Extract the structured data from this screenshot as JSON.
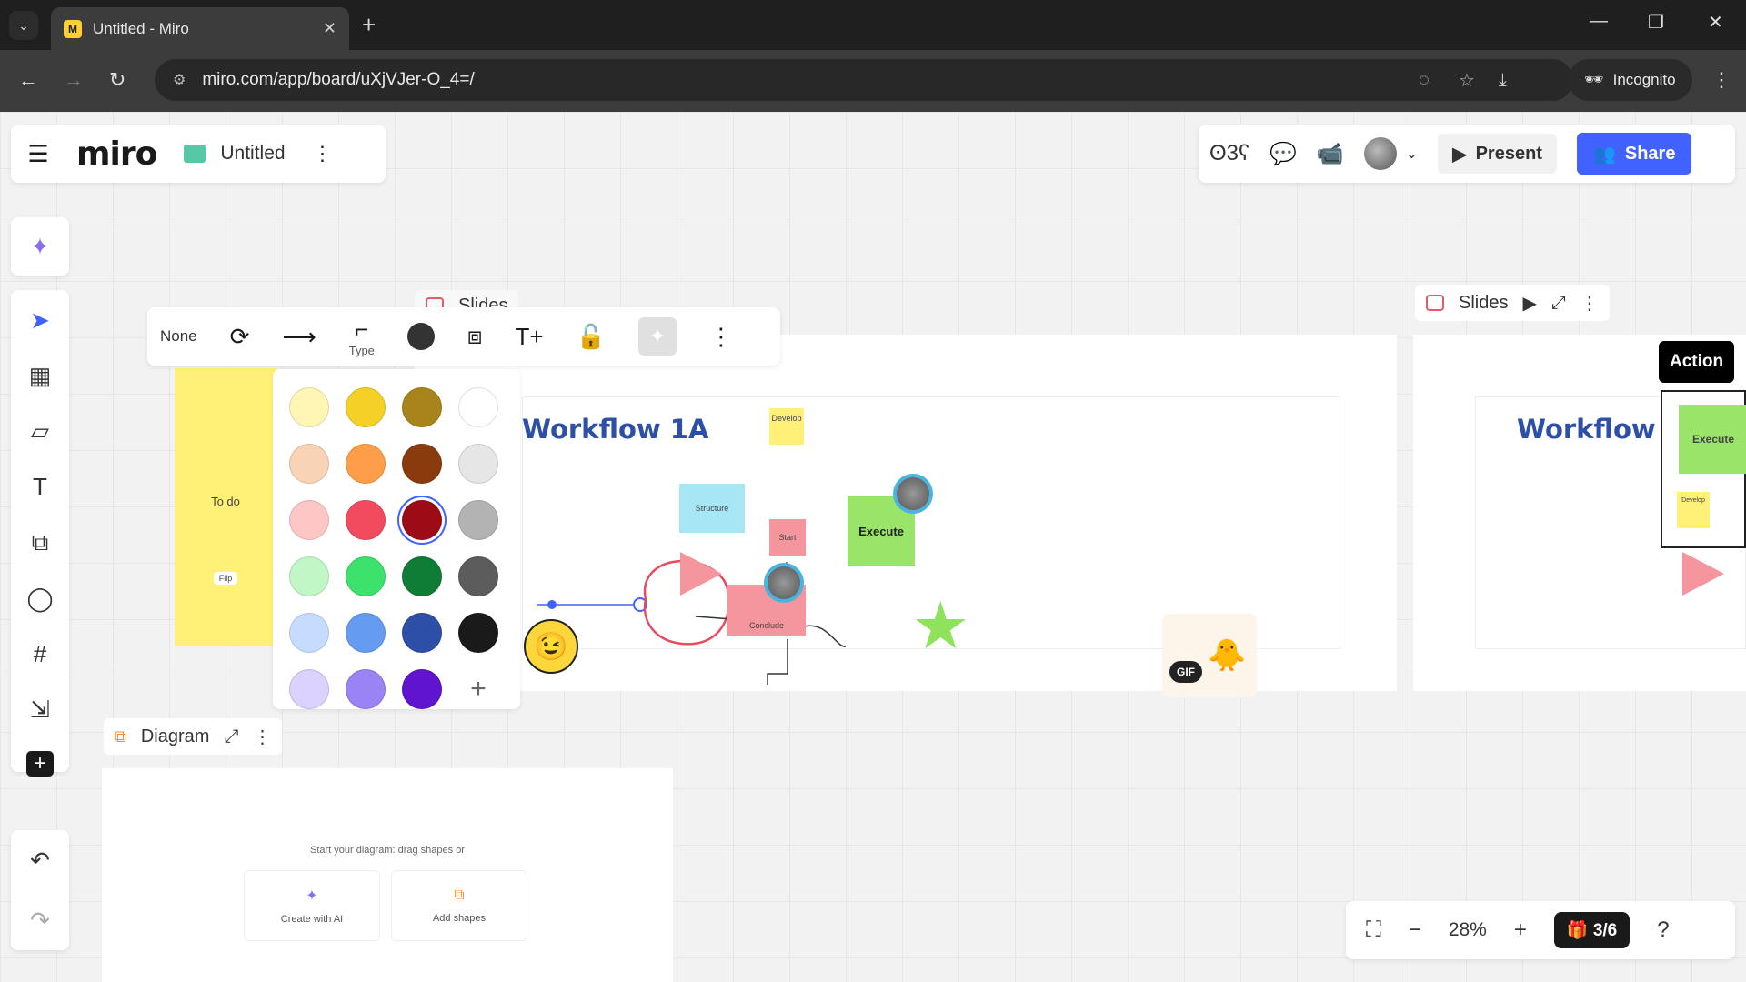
{
  "browser": {
    "tab_title": "Untitled - Miro",
    "favicon_text": "M",
    "url": "miro.com/app/board/uXjVJer-O_4=/",
    "incognito_label": "Incognito"
  },
  "board": {
    "logo": "miro",
    "title": "Untitled"
  },
  "header": {
    "present_label": "Present",
    "share_label": "Share"
  },
  "context_toolbar": {
    "none_label": "None",
    "type_label": "Type"
  },
  "color_picker": {
    "colors": [
      "#fff6b6",
      "#f5d128",
      "#a8841a",
      "#ffffff",
      "#f9d3b6",
      "#ff9d48",
      "#8a3b0d",
      "#e6e6e6",
      "#ffc6c6",
      "#f24a5f",
      "#9d0b17",
      "#b3b3b3",
      "#c1f7c7",
      "#3ce26c",
      "#0f7d35",
      "#5c5c5c",
      "#c6dcff",
      "#659cf2",
      "#2d4fa8",
      "#1a1a1a",
      "#dcd2ff",
      "#9a83f5",
      "#6014ce"
    ],
    "selected_color": "#9d0b17",
    "add_label": "+"
  },
  "frames": {
    "slides_label": "Slides",
    "slides_right_label": "Slides",
    "diagram_label": "Diagram"
  },
  "board_content": {
    "todo_label": "To do",
    "flip_label": "Flip",
    "workflow_title": "Workflow 1A",
    "workflow_title_right": "Workflow",
    "structure_label": "Structure",
    "start_label": "Start",
    "execute_label": "Execute",
    "conclude_label": "Conclude",
    "develop_label": "Develop",
    "gif_label": "GIF",
    "action_label": "Action",
    "execute_right_label": "Execute",
    "develop_right_label": "Develop"
  },
  "diagram": {
    "hint": "Start your diagram: drag shapes or",
    "ai_label": "Create with AI",
    "shapes_label": "Add shapes"
  },
  "zoom": {
    "level": "28%",
    "pages": "3/6"
  }
}
